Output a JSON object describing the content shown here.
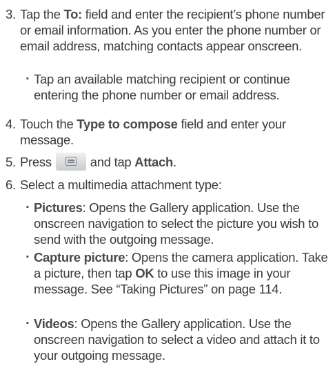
{
  "steps": [
    {
      "num": "3.",
      "pre": "Tap the ",
      "kw": "To:",
      "post": " field and enter the recipient’s phone number or email information. As you enter the phone number or email address, matching contacts appear onscreen."
    },
    {
      "num": "4.",
      "pre": "Touch the ",
      "kw": "Type to compose",
      "post": " field and enter your message."
    },
    {
      "num": "5.",
      "pre": "Press",
      "key_icon": "menu-key-icon",
      "mid": "and tap ",
      "kw": "Attach",
      "post": "."
    },
    {
      "num": "6.",
      "text": "Select a multimedia attachment type:"
    }
  ],
  "step3_bullet": {
    "bullet": "▪",
    "text": "Tap an available matching recipient or continue entering the phone number or email address."
  },
  "step6_bullets": [
    {
      "bullet": "▪",
      "kw": "Pictures",
      "text": ": Opens the Gallery application. Use the onscreen navigation to select the picture you wish to send with the outgoing message."
    },
    {
      "bullet": "▪",
      "kw": "Capture picture",
      "text_a": ": Opens the camera application. Take a picture, then tap ",
      "kw2": "OK",
      "text_b": " to use this image in your message. See “Taking Pictures” on page 114."
    },
    {
      "bullet": "▪",
      "kw": "Videos",
      "text": ": Opens the Gallery application. Use the onscreen navigation to select a video and attach it to your outgoing message."
    }
  ]
}
